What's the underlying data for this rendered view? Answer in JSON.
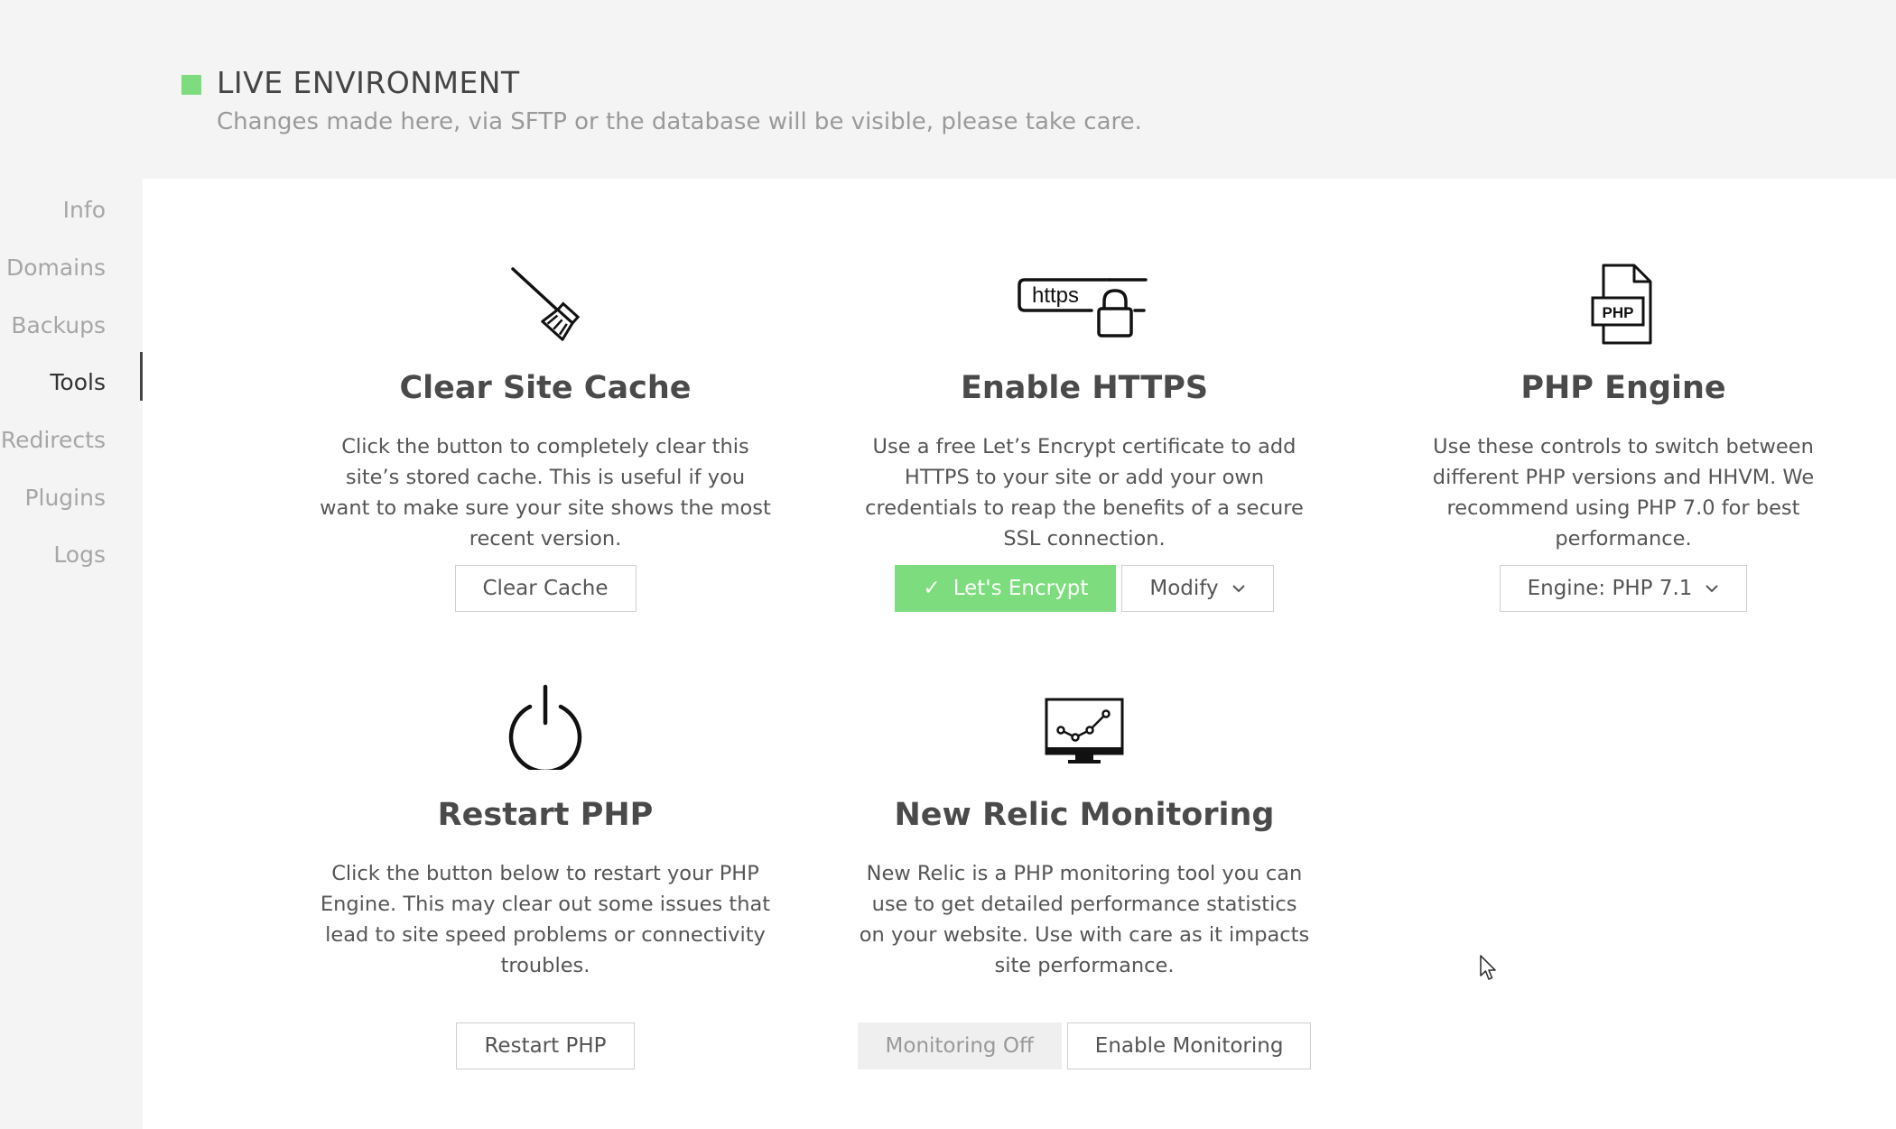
{
  "environment": {
    "title": "LIVE ENVIRONMENT",
    "subtitle": "Changes made here, via SFTP or the database will be visible, please take care.",
    "indicator_color": "#7ddc7d"
  },
  "sidebar": {
    "items": [
      {
        "label": "Info"
      },
      {
        "label": "Domains"
      },
      {
        "label": "Backups"
      },
      {
        "label": "Tools",
        "active": true
      },
      {
        "label": "Redirects"
      },
      {
        "label": "Plugins"
      },
      {
        "label": "Logs"
      }
    ]
  },
  "cards": {
    "clear_cache": {
      "icon": "broom-icon",
      "title": "Clear Site Cache",
      "description": "Click the button to completely clear this site’s stored cache. This is useful if you want to make sure your site shows the most recent version.",
      "button": "Clear Cache"
    },
    "https": {
      "icon": "https-lock-icon",
      "icon_text": "https",
      "title": "Enable HTTPS",
      "description": "Use a free Let’s Encrypt certificate to add HTTPS to your site or add your own credentials to reap the benefits of a secure SSL connection.",
      "button_primary": "Let's Encrypt",
      "button_secondary": "Modify"
    },
    "php_engine": {
      "icon": "php-file-icon",
      "icon_text": "PHP",
      "title": "PHP Engine",
      "description": "Use these controls to switch between different PHP versions and HHVM. We recommend using PHP 7.0 for best performance.",
      "select_value": "Engine: PHP 7.1"
    },
    "restart_php": {
      "icon": "power-icon",
      "title": "Restart PHP",
      "description": "Click the button below to restart your PHP Engine. This may clear out some issues that lead to site speed problems or connectivity troubles.",
      "button": "Restart PHP"
    },
    "new_relic": {
      "icon": "monitor-chart-icon",
      "title": "New Relic Monitoring",
      "description": "New Relic is a PHP monitoring tool you can use to get detailed performance statistics on your website. Use with care as it impacts site performance.",
      "button_status": "Monitoring Off",
      "button_enable": "Enable Monitoring"
    }
  },
  "colors": {
    "accent_green": "#7ddc7d",
    "background": "#f4f4f4",
    "content_bg": "#ffffff"
  }
}
